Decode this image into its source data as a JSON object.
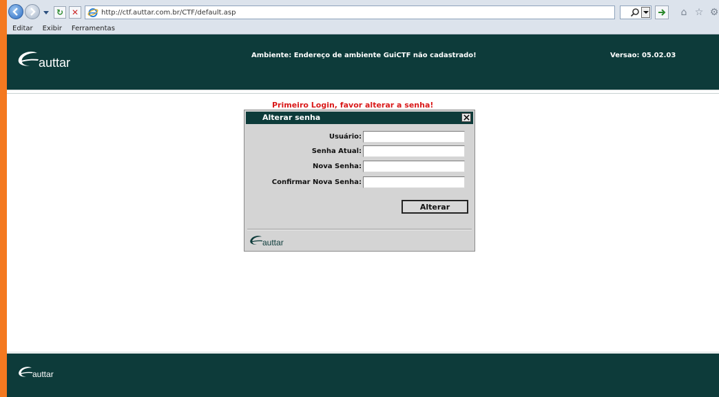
{
  "browser": {
    "url": "http://ctf.auttar.com.br/CTF/default.asp",
    "menu": [
      "Editar",
      "Exibir",
      "Ferramentas"
    ]
  },
  "header": {
    "logo_text": "auttar",
    "ambiente": "Ambiente: Endereço de ambiente GuiCTF não cadastrado!",
    "versao": "Versao: 05.02.03"
  },
  "warning": "Primeiro Login, favor alterar a senha!",
  "dialog": {
    "title": "Alterar senha",
    "fields": {
      "usuario": "Usuário:",
      "senha_atual": "Senha Atual:",
      "nova_senha": "Nova Senha:",
      "confirmar": "Confirmar Nova Senha:"
    },
    "button": "Alterar",
    "logo_text": "auttar"
  },
  "footer": {
    "logo_text": "auttar"
  },
  "colors": {
    "brand_dark_green": "#0d3b3a",
    "warning_red": "#d91a1a",
    "window_border_orange": "#f47920"
  }
}
